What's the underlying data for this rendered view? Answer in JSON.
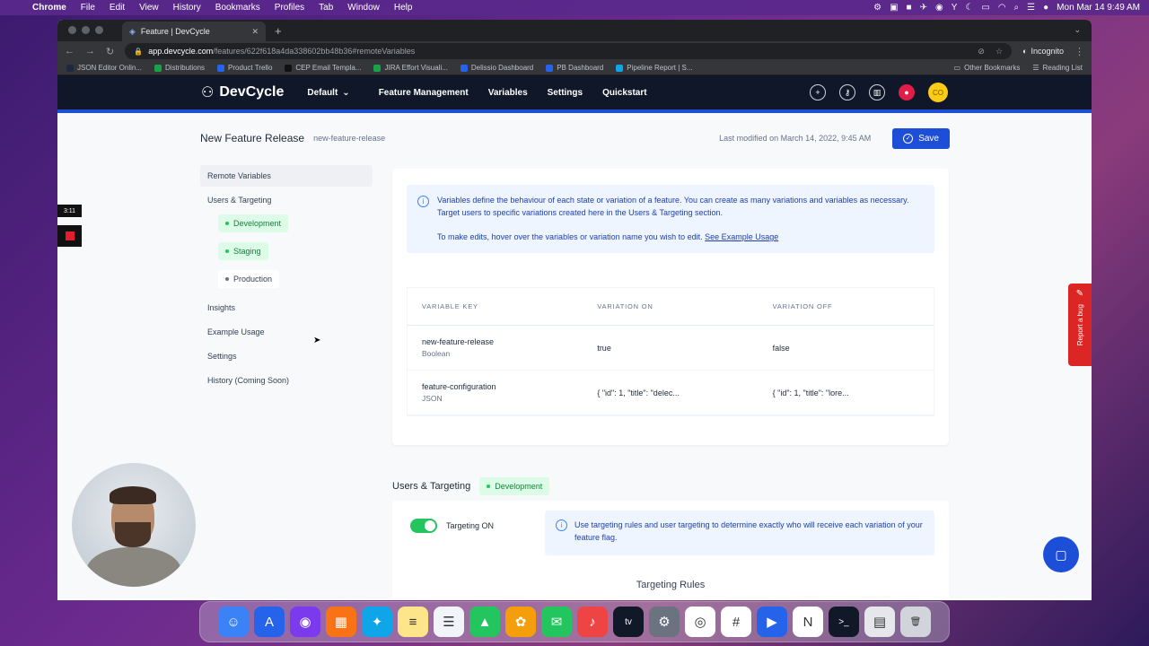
{
  "menubar": {
    "app_name": "Chrome",
    "items": [
      "File",
      "Edit",
      "View",
      "History",
      "Bookmarks",
      "Profiles",
      "Tab",
      "Window",
      "Help"
    ],
    "clock": "Mon Mar 14  9:49 AM"
  },
  "browser": {
    "tab_title": "Feature | DevCycle",
    "url_host": "app.devcycle.com",
    "url_path": "/features/622f618a4da338602bb48b36#remoteVariables",
    "incognito_label": "Incognito",
    "bookmarks": [
      {
        "label": "JSON Editor Onlin...",
        "color": "#1e293b"
      },
      {
        "label": "Distributions",
        "color": "#16a34a"
      },
      {
        "label": "Product Trello",
        "color": "#2563eb"
      },
      {
        "label": "CEP Email Templa...",
        "color": "#111111"
      },
      {
        "label": "JIRA Effort Visuali...",
        "color": "#16a34a"
      },
      {
        "label": "Delissio Dashboard",
        "color": "#2563eb"
      },
      {
        "label": "PB Dashboard",
        "color": "#2563eb"
      },
      {
        "label": "Pipeline Report | S...",
        "color": "#0ea5e9"
      }
    ],
    "other_bookmarks": "Other Bookmarks",
    "reading_list": "Reading List"
  },
  "appnav": {
    "logo": "DevCycle",
    "environment": "Default",
    "links": [
      "Feature Management",
      "Variables",
      "Settings",
      "Quickstart"
    ],
    "avatar_initials": "CO"
  },
  "feature": {
    "name": "New Feature Release",
    "key": "new-feature-release",
    "last_modified": "Last modified on March 14, 2022, 9:45 AM",
    "save_label": "Save"
  },
  "sidebar": {
    "remote_variables": "Remote Variables",
    "users_targeting": "Users & Targeting",
    "environments": [
      "Development",
      "Staging",
      "Production"
    ],
    "insights": "Insights",
    "example_usage": "Example Usage",
    "settings": "Settings",
    "history": "History (Coming Soon)"
  },
  "info": {
    "line1": "Variables define the behaviour of each state or variation of a feature. You can create as many variations and variables as necessary. Target users to specific variations created here in the Users & Targeting section.",
    "line2": "To make edits, hover over the variables or variation name you wish to edit.",
    "link": "See Example Usage"
  },
  "variables_table": {
    "headers": [
      "VARIABLE KEY",
      "VARIATION ON",
      "VARIATION OFF"
    ],
    "rows": [
      {
        "key": "new-feature-release",
        "type": "Boolean",
        "on": "true",
        "off": "false"
      },
      {
        "key": "feature-configuration",
        "type": "JSON",
        "on": "{ \"id\": 1, \"title\": \"delec...",
        "off": "{ \"id\": 1, \"title\": \"lore..."
      }
    ]
  },
  "targeting": {
    "section_title": "Users & Targeting",
    "env_badge": "Development",
    "toggle_label": "Targeting ON",
    "toggle_on": true,
    "info": "Use targeting rules and user targeting to determine exactly who will receive each variation of your feature flag.",
    "rules_label": "Targeting Rules"
  },
  "widgets": {
    "report_bug": "Report a bug",
    "recording_timer": "3:11"
  },
  "dock": [
    {
      "name": "finder-icon",
      "color": "#3b82f6",
      "glyph": "☺"
    },
    {
      "name": "app-store-icon",
      "color": "#2563eb",
      "glyph": "A"
    },
    {
      "name": "siri-icon",
      "color": "#7c3aed",
      "glyph": "◉"
    },
    {
      "name": "launchpad-icon",
      "color": "#f97316",
      "glyph": "▦"
    },
    {
      "name": "safari-icon",
      "color": "#0ea5e9",
      "glyph": "✦"
    },
    {
      "name": "notes-icon",
      "color": "#fde68a",
      "glyph": "≡"
    },
    {
      "name": "reminders-icon",
      "color": "#f1f5f9",
      "glyph": "☰"
    },
    {
      "name": "maps-icon",
      "color": "#22c55e",
      "glyph": "▲"
    },
    {
      "name": "photos-icon",
      "color": "#f59e0b",
      "glyph": "✿"
    },
    {
      "name": "messages-icon",
      "color": "#22c55e",
      "glyph": "✉"
    },
    {
      "name": "music-icon",
      "color": "#ef4444",
      "glyph": "♪"
    },
    {
      "name": "tv-icon",
      "color": "#111827",
      "glyph": "tv"
    },
    {
      "name": "system-preferences-icon",
      "color": "#6b7280",
      "glyph": "⚙"
    },
    {
      "name": "chrome-icon",
      "color": "#ffffff",
      "glyph": "◎"
    },
    {
      "name": "slack-icon",
      "color": "#ffffff",
      "glyph": "#"
    },
    {
      "name": "zoom-icon",
      "color": "#2563eb",
      "glyph": "▶"
    },
    {
      "name": "notion-icon",
      "color": "#ffffff",
      "glyph": "N"
    },
    {
      "name": "terminal-icon",
      "color": "#111827",
      "glyph": ">_"
    },
    {
      "name": "document-icon",
      "color": "#e5e7eb",
      "glyph": "▤"
    },
    {
      "name": "trash-icon",
      "color": "#d1d5db",
      "glyph": "🗑"
    }
  ]
}
